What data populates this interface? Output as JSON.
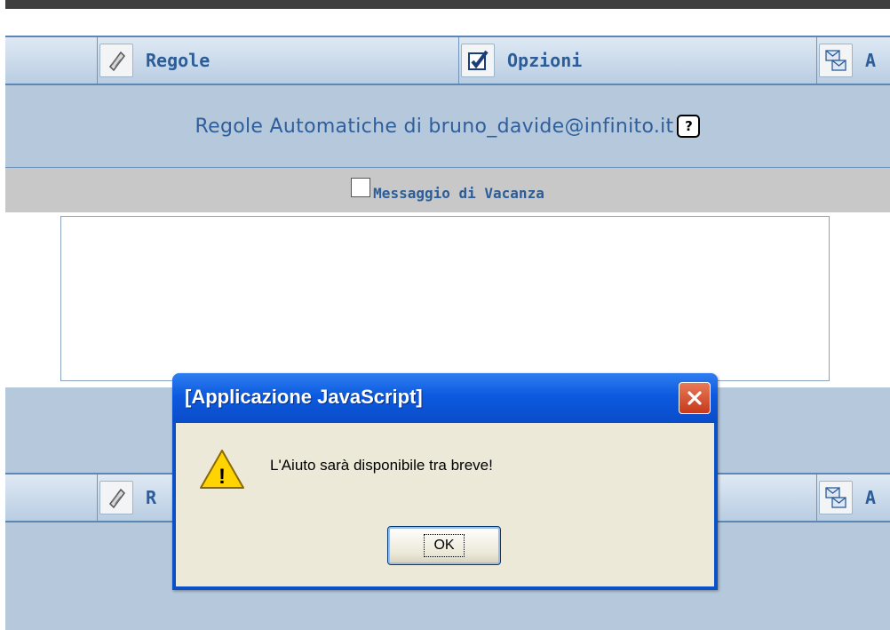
{
  "tabs": {
    "rules_label": "Regole",
    "options_label": "Opzioni",
    "third_label": "A",
    "bottom_rules_label": "R",
    "bottom_third_label": "A"
  },
  "heading": {
    "title": "Regole Automatiche di bruno_davide@infinito.it",
    "help_glyph": "?"
  },
  "vacation": {
    "label": "Messaggio di Vacanza",
    "checked": false,
    "message_value": ""
  },
  "dialog": {
    "title": "[Applicazione JavaScript]",
    "message": "L'Aiuto sarà disponibile tra breve!",
    "ok_label": "OK",
    "icon": "warning-icon",
    "warning_glyph": "!"
  },
  "colors": {
    "page_bg": "#b5c8dc",
    "accent_text": "#2c5d98",
    "dialog_blue": "#0a51c8",
    "close_red": "#c6391b"
  }
}
